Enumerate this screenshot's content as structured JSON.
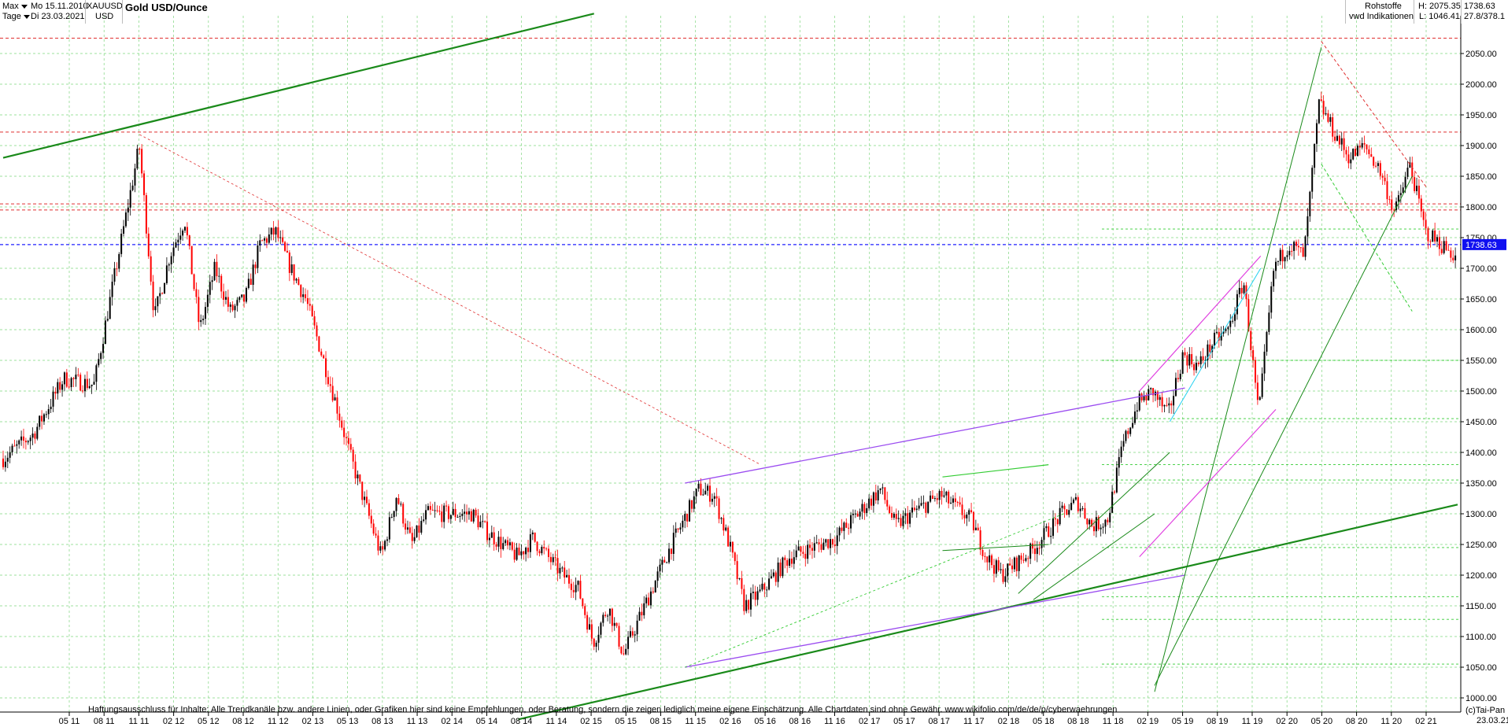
{
  "header": {
    "range_select": "Max",
    "period_select": "Tage",
    "date_from": "Mo 15.11.2010",
    "date_to": "Di 23.03.2021",
    "symbol": "XAUUSD",
    "currency": "USD",
    "title": "Gold USD/Ounce",
    "source_line1": "Rohstoffe",
    "source_line2": "vwd Indikationen",
    "high_label": "H: 2075.35",
    "low_label": "L: 1046.41",
    "last_value": "1738.63",
    "ratio": "27.8/378.1"
  },
  "footer": {
    "disclaimer": "Haftungsausschluss für Inhalte: Alle Trendkanäle bzw. andere Linien, oder Grafiken hier sind keine Empfehlungen, oder Beratung, sondern die zeigen lediglich meine eigene Einschätzung. Alle Chartdaten sind ohne Gewähr.  www.wikifolio.com/de/de/p/cyberwaehrungen",
    "copyright": "(c)Tai-Pan",
    "end_date": "23.03.21"
  },
  "colors": {
    "candle_up": "#000000",
    "candle_down": "#ff0000",
    "grid": "#7fd67f",
    "resistance": "#e03030",
    "current_price": "#2020ff",
    "trend_dark": "#1a8a1a",
    "trend_light": "#33cc33",
    "trend_purple": "#9b4cf0",
    "trend_magenta": "#e040e0",
    "trend_cyan": "#20d0f0",
    "price_tag": "#1010f0"
  },
  "chart_data": {
    "type": "candlestick",
    "title": "Gold USD/Ounce",
    "series_name": "XAUUSD",
    "ylim": [
      1000,
      2100
    ],
    "y_ticks": [
      1000,
      1050,
      1100,
      1150,
      1200,
      1250,
      1300,
      1350,
      1400,
      1450,
      1500,
      1550,
      1600,
      1650,
      1700,
      1750,
      1800,
      1850,
      1900,
      1950,
      2000,
      2050
    ],
    "x_ticks": [
      "05 11",
      "08 11",
      "11 11",
      "02 12",
      "05 12",
      "08 12",
      "11 12",
      "02 13",
      "05 13",
      "08 13",
      "11 13",
      "02 14",
      "05 14",
      "08 14",
      "11 14",
      "02 15",
      "05 15",
      "08 15",
      "11 15",
      "02 16",
      "05 16",
      "08 16",
      "11 16",
      "02 17",
      "05 17",
      "08 17",
      "11 17",
      "02 18",
      "05 18",
      "08 18",
      "11 18",
      "02 19",
      "05 19",
      "08 19",
      "11 19",
      "02 20",
      "05 20",
      "08 20",
      "11 20",
      "02 21"
    ],
    "path_keypoints": [
      [
        0,
        1390
      ],
      [
        2,
        1430
      ],
      [
        4,
        1520
      ],
      [
        6,
        1510
      ],
      [
        9,
        1900
      ],
      [
        10,
        1620
      ],
      [
        11,
        1720
      ],
      [
        12,
        1780
      ],
      [
        13,
        1600
      ],
      [
        14,
        1700
      ],
      [
        15,
        1630
      ],
      [
        16,
        1650
      ],
      [
        17,
        1740
      ],
      [
        18,
        1760
      ],
      [
        19,
        1700
      ],
      [
        20,
        1650
      ],
      [
        22,
        1480
      ],
      [
        23,
        1390
      ],
      [
        25,
        1230
      ],
      [
        26,
        1330
      ],
      [
        27,
        1250
      ],
      [
        28,
        1300
      ],
      [
        31,
        1300
      ],
      [
        32,
        1270
      ],
      [
        34,
        1230
      ],
      [
        35,
        1260
      ],
      [
        36,
        1230
      ],
      [
        37,
        1200
      ],
      [
        38,
        1180
      ],
      [
        39,
        1090
      ],
      [
        40,
        1150
      ],
      [
        41,
        1070
      ],
      [
        44,
        1240
      ],
      [
        46,
        1340
      ],
      [
        47,
        1330
      ],
      [
        48,
        1250
      ],
      [
        49,
        1150
      ],
      [
        50,
        1170
      ],
      [
        51,
        1200
      ],
      [
        52,
        1230
      ],
      [
        54,
        1250
      ],
      [
        55,
        1260
      ],
      [
        58,
        1340
      ],
      [
        59,
        1280
      ],
      [
        60,
        1300
      ],
      [
        62,
        1330
      ],
      [
        64,
        1290
      ],
      [
        65,
        1230
      ],
      [
        66,
        1200
      ],
      [
        67,
        1220
      ],
      [
        68,
        1240
      ],
      [
        70,
        1300
      ],
      [
        71,
        1320
      ],
      [
        72,
        1280
      ],
      [
        73,
        1290
      ],
      [
        74,
        1410
      ],
      [
        75,
        1480
      ],
      [
        76,
        1500
      ],
      [
        77,
        1460
      ],
      [
        78,
        1560
      ],
      [
        79,
        1540
      ],
      [
        80,
        1580
      ],
      [
        81,
        1600
      ],
      [
        82,
        1680
      ],
      [
        83,
        1460
      ],
      [
        84,
        1700
      ],
      [
        85,
        1740
      ],
      [
        86,
        1720
      ],
      [
        87,
        1970
      ],
      [
        88,
        1920
      ],
      [
        89,
        1880
      ],
      [
        90,
        1900
      ],
      [
        91,
        1860
      ],
      [
        92,
        1790
      ],
      [
        93,
        1870
      ],
      [
        94,
        1760
      ],
      [
        95,
        1740
      ],
      [
        96,
        1720
      ]
    ],
    "key_levels": {
      "resistance": [
        2075,
        1922,
        1805,
        1795
      ],
      "current": 1738.63,
      "green_dashed": [
        1764,
        1550,
        1455,
        1380,
        1355,
        1245,
        1165,
        1128,
        1055
      ]
    },
    "high": 2075.35,
    "low": 1046.41,
    "last": 1738.63
  }
}
